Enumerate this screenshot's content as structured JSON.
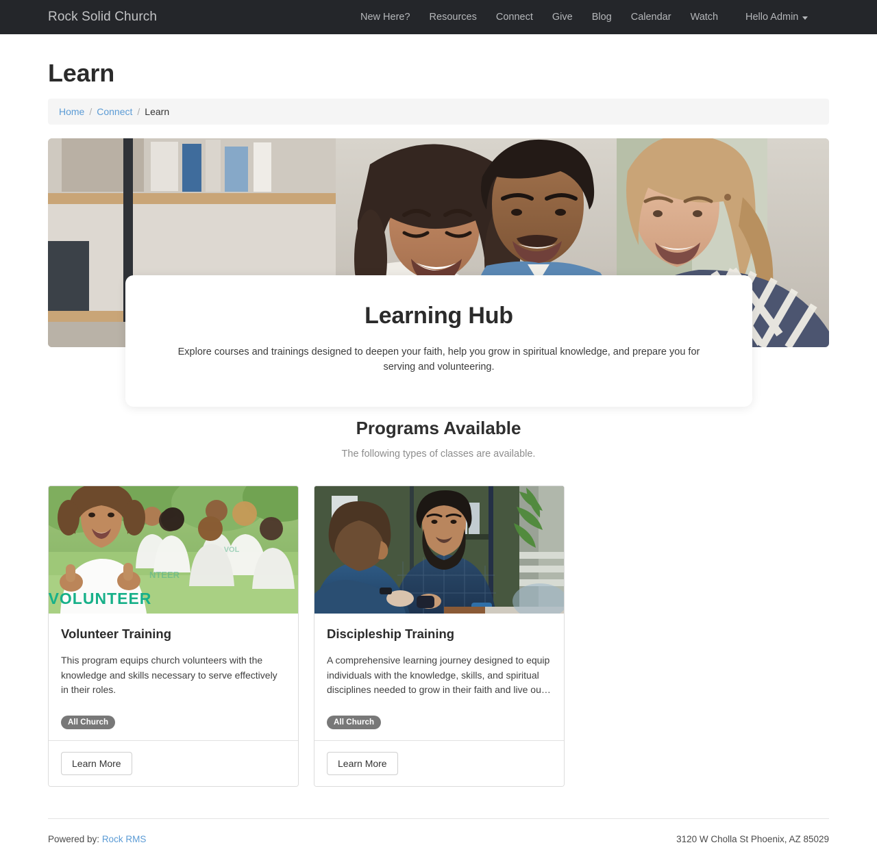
{
  "navbar": {
    "brand": "Rock Solid Church",
    "links": [
      {
        "label": "New Here?"
      },
      {
        "label": "Resources"
      },
      {
        "label": "Connect"
      },
      {
        "label": "Give"
      },
      {
        "label": "Blog"
      },
      {
        "label": "Calendar"
      },
      {
        "label": "Watch"
      }
    ],
    "user_label": "Hello Admin",
    "user_caret_icon": "chevron-down-icon",
    "background_color": "#24262a",
    "link_color": "#b5b7ba"
  },
  "page": {
    "title": "Learn"
  },
  "breadcrumb": {
    "items": [
      {
        "label": "Home",
        "link": true
      },
      {
        "label": "Connect",
        "link": true
      },
      {
        "label": "Learn",
        "link": false
      }
    ],
    "separator": "/",
    "link_color": "#5b9bd5",
    "background_color": "#f5f5f5"
  },
  "hero": {
    "image_alt": "three-people-smiling-at-laptop",
    "title": "Learning Hub",
    "description": "Explore courses and trainings designed to deepen your faith, help you grow in spiritual knowledge, and prepare you for serving and volunteering."
  },
  "programs": {
    "heading": "Programs Available",
    "subheading": "The following types of classes are available.",
    "cards": [
      {
        "image_alt": "volunteer-group-outdoors",
        "title": "Volunteer Training",
        "description": "This program equips church volunteers with the knowledge and skills necessary to serve effectively in their roles.",
        "badge": "All Church",
        "badge_color": "#787878",
        "button_label": "Learn More"
      },
      {
        "image_alt": "two-men-in-conversation-indoors",
        "title": "Discipleship Training",
        "description": "A comprehensive learning journey designed to equip individuals with the knowledge, skills, and spiritual disciplines needed to grow in their faith and live ou…",
        "badge": "All Church",
        "badge_color": "#787878",
        "button_label": "Learn More"
      }
    ]
  },
  "footer": {
    "powered_by_label": "Powered by:",
    "powered_by_link": "Rock RMS",
    "address": "3120 W Cholla St Phoenix, AZ 85029"
  }
}
